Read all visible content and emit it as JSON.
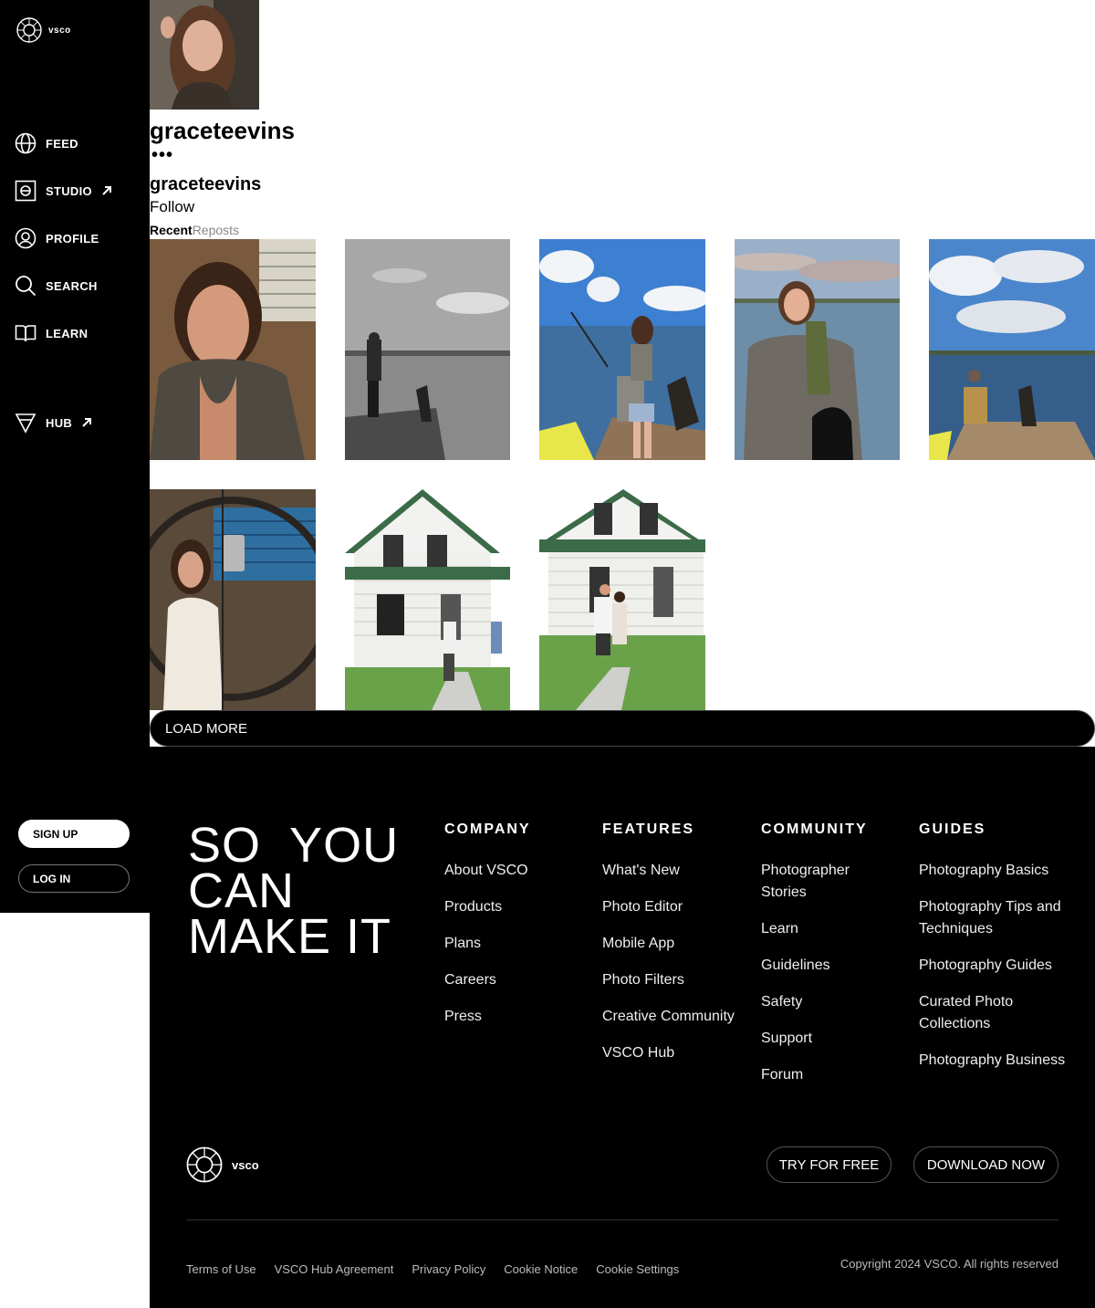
{
  "brand": {
    "name": "VSCO"
  },
  "sidebar": {
    "logo_text": "vsco",
    "nav": [
      {
        "label": "FEED",
        "icon": "globe-icon"
      },
      {
        "label": "STUDIO",
        "icon": "studio-icon",
        "external": true
      },
      {
        "label": "PROFILE",
        "icon": "profile-icon"
      },
      {
        "label": "SEARCH",
        "icon": "search-icon"
      },
      {
        "label": "LEARN",
        "icon": "book-icon"
      },
      {
        "label": "HUB",
        "icon": "hub-icon",
        "external": true
      }
    ],
    "signup_label": "SIGN UP",
    "login_label": "LOG IN"
  },
  "profile": {
    "username": "graceteevins",
    "display_name": "graceteevins",
    "more_label": "•••",
    "follow_label": "Follow",
    "tabs": [
      "Recent",
      "Reposts"
    ]
  },
  "gallery": {
    "photos": [
      {
        "alt": "selfie in life vest"
      },
      {
        "alt": "black and white dock with dog"
      },
      {
        "alt": "fishing on dock with dog"
      },
      {
        "alt": "holding fish with dog"
      },
      {
        "alt": "sitting on dock chair with dog"
      },
      {
        "alt": "mirror selfie"
      },
      {
        "alt": "white house front"
      },
      {
        "alt": "couple in front of sold house"
      }
    ],
    "load_more_label": "LOAD MORE"
  },
  "footer": {
    "tagline": [
      "SO  YOU",
      "CAN",
      "MAKE IT"
    ],
    "columns": [
      {
        "heading": "COMPANY",
        "links": [
          "About VSCO",
          "Products",
          "Plans",
          "Careers",
          "Press"
        ]
      },
      {
        "heading": "FEATURES",
        "links": [
          "What's New",
          "Photo Editor",
          "Mobile App",
          "Photo Filters",
          "Creative Community",
          "VSCO Hub"
        ]
      },
      {
        "heading": "COMMUNITY",
        "links": [
          "Photographer Stories",
          "Learn",
          "Guidelines",
          "Safety",
          "Support",
          "Forum"
        ]
      },
      {
        "heading": "GUIDES",
        "links": [
          "Photography Basics",
          "Photography Tips and Techniques",
          "Photography Guides",
          "Curated Photo Collections",
          "Photography Business"
        ]
      }
    ],
    "logo_text": "vsco",
    "try_label": "TRY FOR FREE",
    "download_label": "DOWNLOAD NOW",
    "legal_links": [
      "Terms of Use",
      "VSCO Hub Agreement",
      "Privacy Policy",
      "Cookie Notice",
      "Cookie Settings"
    ],
    "copyright": "Copyright 2024 VSCO. All rights reserved"
  }
}
